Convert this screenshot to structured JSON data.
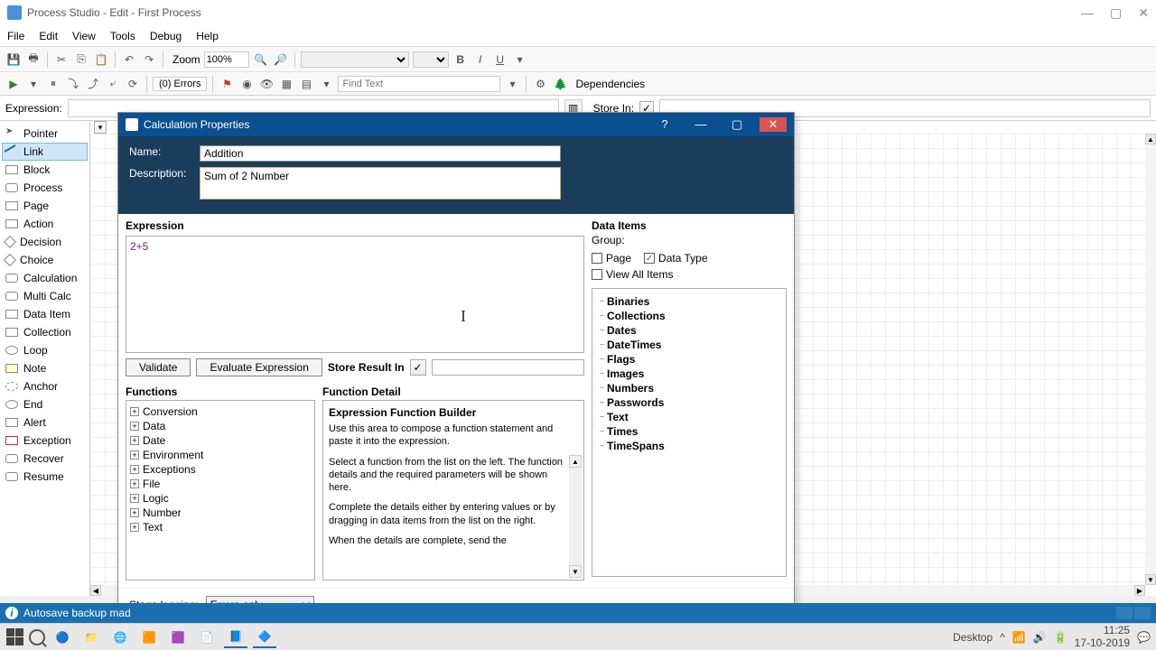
{
  "title": "Process Studio  - Edit -  First Process",
  "menus": [
    "File",
    "Edit",
    "View",
    "Tools",
    "Debug",
    "Help"
  ],
  "toolbar1": {
    "zoom_label": "Zoom",
    "zoom_value": "100%"
  },
  "toolbar2": {
    "errors": "(0) Errors",
    "find_placeholder": "Find Text",
    "dependencies": "Dependencies"
  },
  "exprbar": {
    "label": "Expression:",
    "store_label": "Store In:"
  },
  "palette": [
    "Pointer",
    "Link",
    "Block",
    "Process",
    "Page",
    "Action",
    "Decision",
    "Choice",
    "Calculation",
    "Multi Calc",
    "Data Item",
    "Collection",
    "Loop",
    "Note",
    "Anchor",
    "End",
    "Alert",
    "Exception",
    "Recover",
    "Resume"
  ],
  "dialog": {
    "title": "Calculation Properties",
    "name_label": "Name:",
    "name_value": "Addition",
    "desc_label": "Description:",
    "desc_value": "Sum of 2 Number",
    "expr_label": "Expression",
    "expr_value": "2+5",
    "validate_btn": "Validate",
    "eval_btn": "Evaluate Expression",
    "store_label": "Store Result In",
    "functions_label": "Functions",
    "functions": [
      "Conversion",
      "Data",
      "Date",
      "Environment",
      "Exceptions",
      "File",
      "Logic",
      "Number",
      "Text"
    ],
    "func_detail_label": "Function Detail",
    "fd_title": "Expression Function Builder",
    "fd_p1": "Use this area to compose a function statement and paste it into the expression.",
    "fd_p2": "Select a function from the list on the left. The function details and the required parameters will be shown here.",
    "fd_p3": "Complete the details either by entering values or by dragging in data items from the list on the right.",
    "fd_p4": "When the details are complete, send the",
    "di_label": "Data Items",
    "di_group": "Group:",
    "chk_page": "Page",
    "chk_datatype": "Data Type",
    "chk_viewall": "View All Items",
    "di_cats": [
      "Binaries",
      "Collections",
      "Dates",
      "DateTimes",
      "Flags",
      "Images",
      "Numbers",
      "Passwords",
      "Text",
      "Times",
      "TimeSpans"
    ],
    "footer_label": "Stage logging:",
    "footer_value": "Errors only"
  },
  "statusbar": {
    "msg": "Autosave backup mad",
    "desktop": "Desktop"
  },
  "tray": {
    "time": "11:25",
    "date": "17-10-2019"
  }
}
